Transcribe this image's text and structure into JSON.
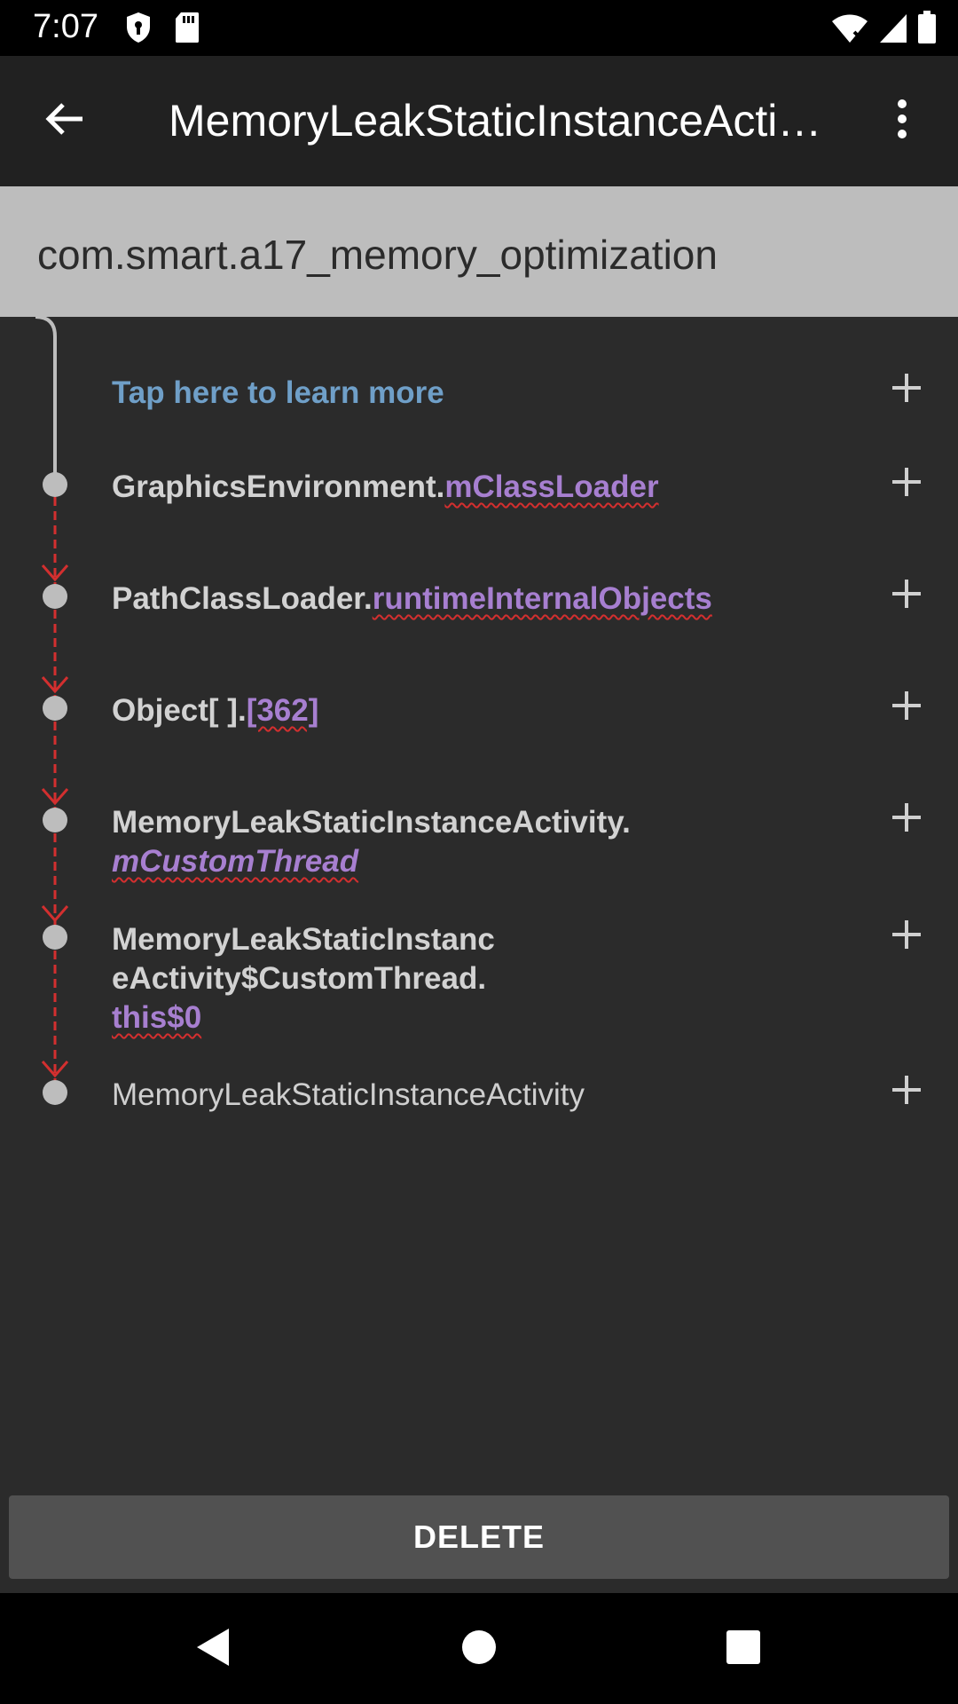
{
  "status_bar": {
    "time": "7:07",
    "icons": [
      "shield-icon",
      "sd-card-icon",
      "wifi-icon",
      "signal-icon",
      "battery-icon"
    ]
  },
  "app_bar": {
    "title": "MemoryLeakStaticInstanceActivity",
    "back_icon": "arrow-back-icon",
    "menu_icon": "more-vert-icon"
  },
  "package": {
    "name": "com.smart.a17_memory_optimization"
  },
  "trace": {
    "learn_more": "Tap here to learn more",
    "rows": [
      {
        "class_name": "GraphicsEnvironment.",
        "field": "mClassLoader"
      },
      {
        "class_name": "PathClassLoader.",
        "field": "runtimeInternalObjects"
      },
      {
        "class_name": "Object[ ].",
        "field": "[362]"
      },
      {
        "class_name": "MemoryLeakStaticInstanceActivity.",
        "field": "mCustomThread"
      },
      {
        "class_name_line1": "MemoryLeakStaticInstanc",
        "class_name_line2": "eActivity$CustomThread.",
        "field": "this$0"
      },
      {
        "class_name": "MemoryLeakStaticInstanceActivity"
      }
    ],
    "expand_icon": "plus-icon",
    "colors": {
      "leak_line": "#d32f2f",
      "field": "#a77fd0",
      "link": "#6f9fc8",
      "node": "#bdbdbd"
    }
  },
  "actions": {
    "delete_label": "DELETE"
  },
  "nav_bar": {
    "icons": [
      "back-triangle-icon",
      "home-circle-icon",
      "recents-square-icon"
    ]
  }
}
